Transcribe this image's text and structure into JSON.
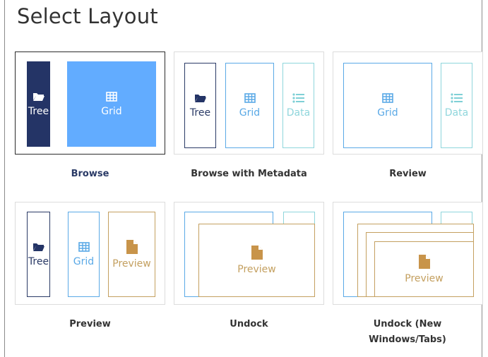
{
  "title": "Select Layout",
  "selected": "Browse",
  "colors": {
    "navy": "#243466",
    "blue": "#62acff",
    "blue_line": "#5aa9e6",
    "teal": "#8fd6dc",
    "gold": "#c4a060"
  },
  "panes": {
    "tree": "Tree",
    "grid": "Grid",
    "data": "Data",
    "preview": "Preview"
  },
  "icons": {
    "tree": "folder-icon",
    "grid": "table-icon",
    "data": "list-icon",
    "preview": "document-icon"
  },
  "layouts": [
    {
      "label": "Browse"
    },
    {
      "label": "Browse with Metadata"
    },
    {
      "label": "Review"
    },
    {
      "label": "Preview"
    },
    {
      "label": "Undock"
    },
    {
      "label": "Undock (New Windows/Tabs)"
    }
  ]
}
